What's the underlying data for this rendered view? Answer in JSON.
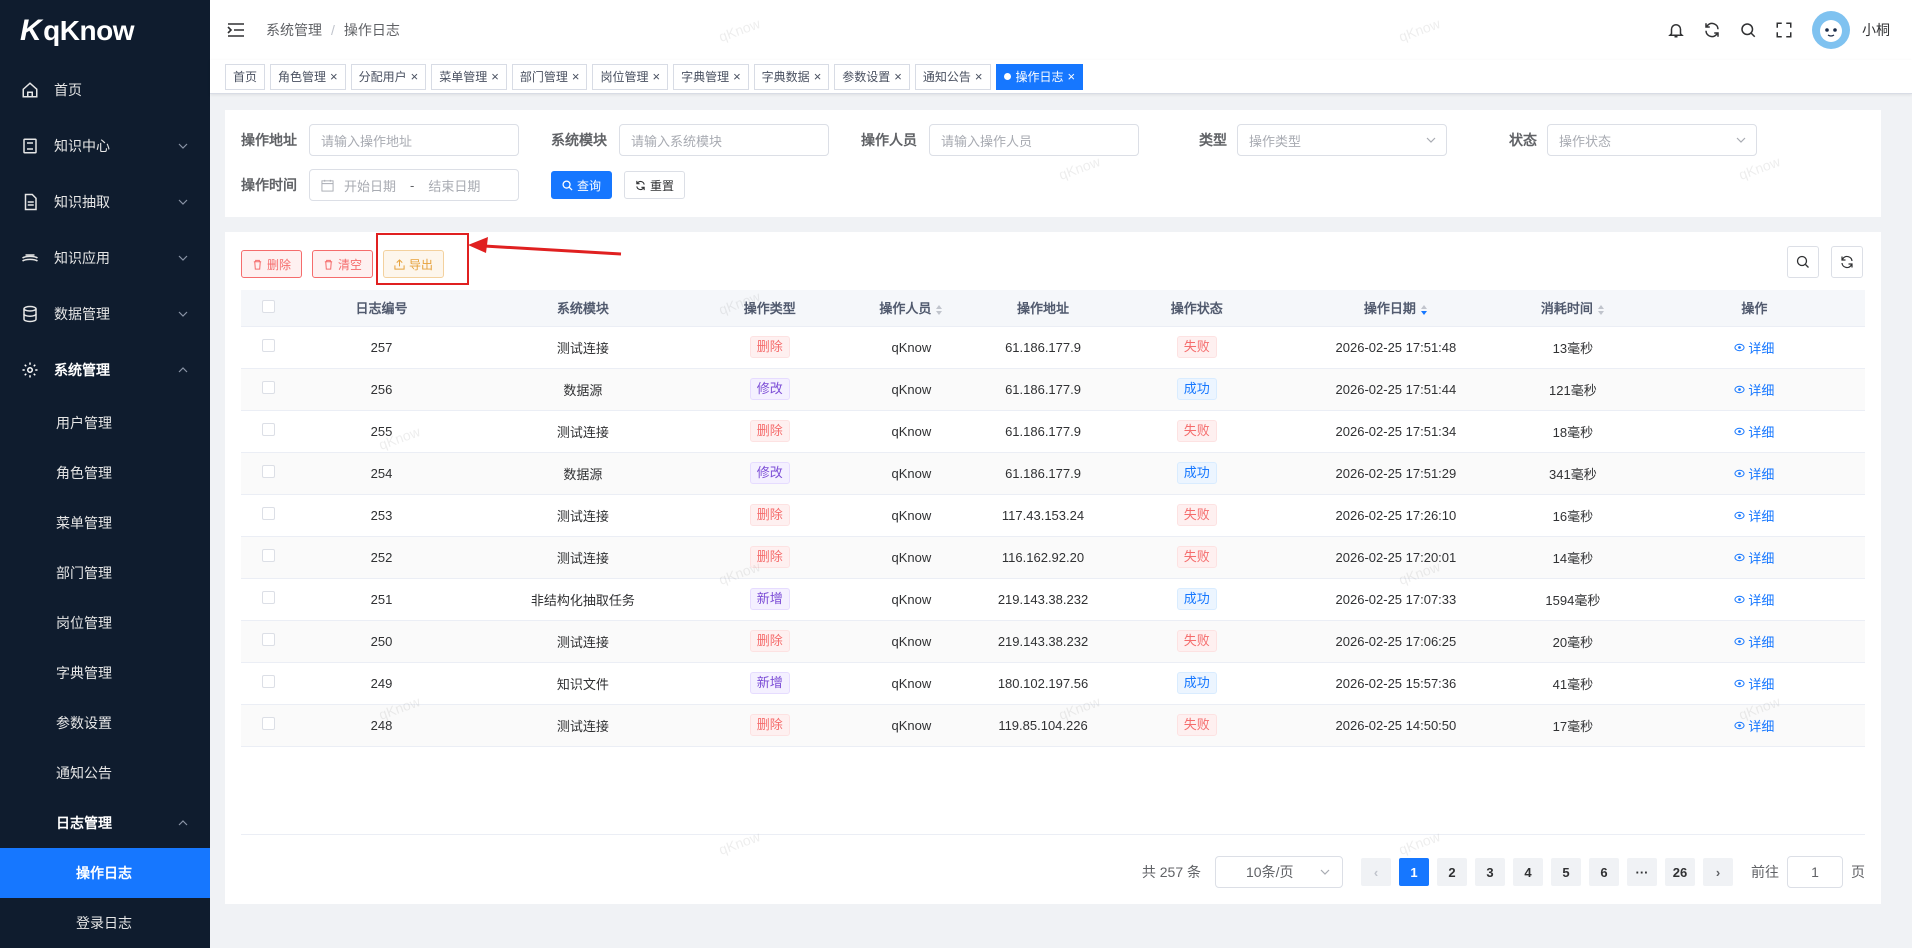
{
  "app": {
    "logo_text": "qKnow",
    "logo_mark": "K"
  },
  "sidebar": {
    "items": [
      {
        "label": "首页",
        "icon": "home-icon"
      },
      {
        "label": "知识中心",
        "icon": "book-icon"
      },
      {
        "label": "知识抽取",
        "icon": "document-icon"
      },
      {
        "label": "知识应用",
        "icon": "stack-icon"
      },
      {
        "label": "数据管理",
        "icon": "database-icon"
      },
      {
        "label": "系统管理",
        "icon": "gear-icon"
      }
    ],
    "system_children": [
      "用户管理",
      "角色管理",
      "菜单管理",
      "部门管理",
      "岗位管理",
      "字典管理",
      "参数设置",
      "通知公告"
    ],
    "log_group": "日志管理",
    "log_children": [
      "操作日志",
      "登录日志"
    ]
  },
  "header": {
    "breadcrumb": [
      "系统管理",
      "操作日志"
    ],
    "username": "小桐"
  },
  "tags": [
    {
      "label": "首页",
      "closable": false,
      "active": false
    },
    {
      "label": "角色管理",
      "closable": true,
      "active": false
    },
    {
      "label": "分配用户",
      "closable": true,
      "active": false
    },
    {
      "label": "菜单管理",
      "closable": true,
      "active": false
    },
    {
      "label": "部门管理",
      "closable": true,
      "active": false
    },
    {
      "label": "岗位管理",
      "closable": true,
      "active": false
    },
    {
      "label": "字典管理",
      "closable": true,
      "active": false
    },
    {
      "label": "字典数据",
      "closable": true,
      "active": false
    },
    {
      "label": "参数设置",
      "closable": true,
      "active": false
    },
    {
      "label": "通知公告",
      "closable": true,
      "active": false
    },
    {
      "label": "操作日志",
      "closable": true,
      "active": true
    }
  ],
  "search": {
    "oper_url_label": "操作地址",
    "oper_url_placeholder": "请输入操作地址",
    "module_label": "系统模块",
    "module_placeholder": "请输入系统模块",
    "oper_name_label": "操作人员",
    "oper_name_placeholder": "请输入操作人员",
    "type_label": "类型",
    "type_placeholder": "操作类型",
    "status_label": "状态",
    "status_placeholder": "操作状态",
    "time_label": "操作时间",
    "start_placeholder": "开始日期",
    "range_sep": "-",
    "end_placeholder": "结束日期",
    "query_btn": "查询",
    "reset_btn": "重置"
  },
  "toolbar": {
    "delete_btn": "删除",
    "clear_btn": "清空",
    "export_btn": "导出"
  },
  "table": {
    "headers": [
      "日志编号",
      "系统模块",
      "操作类型",
      "操作人员",
      "操作地址",
      "操作状态",
      "操作日期",
      "消耗时间",
      "操作"
    ],
    "detail_label": "详细",
    "rows": [
      {
        "id": "257",
        "module": "测试连接",
        "type": "删除",
        "type_color": "red",
        "user": "qKnow",
        "ip": "61.186.177.9",
        "status": "失败",
        "status_color": "red",
        "time": "2026-02-25 17:51:48",
        "cost": "13毫秒"
      },
      {
        "id": "256",
        "module": "数据源",
        "type": "修改",
        "type_color": "purple",
        "user": "qKnow",
        "ip": "61.186.177.9",
        "status": "成功",
        "status_color": "blue",
        "time": "2026-02-25 17:51:44",
        "cost": "121毫秒"
      },
      {
        "id": "255",
        "module": "测试连接",
        "type": "删除",
        "type_color": "red",
        "user": "qKnow",
        "ip": "61.186.177.9",
        "status": "失败",
        "status_color": "red",
        "time": "2026-02-25 17:51:34",
        "cost": "18毫秒"
      },
      {
        "id": "254",
        "module": "数据源",
        "type": "修改",
        "type_color": "purple",
        "user": "qKnow",
        "ip": "61.186.177.9",
        "status": "成功",
        "status_color": "blue",
        "time": "2026-02-25 17:51:29",
        "cost": "341毫秒"
      },
      {
        "id": "253",
        "module": "测试连接",
        "type": "删除",
        "type_color": "red",
        "user": "qKnow",
        "ip": "117.43.153.24",
        "status": "失败",
        "status_color": "red",
        "time": "2026-02-25 17:26:10",
        "cost": "16毫秒"
      },
      {
        "id": "252",
        "module": "测试连接",
        "type": "删除",
        "type_color": "red",
        "user": "qKnow",
        "ip": "116.162.92.20",
        "status": "失败",
        "status_color": "red",
        "time": "2026-02-25 17:20:01",
        "cost": "14毫秒"
      },
      {
        "id": "251",
        "module": "非结构化抽取任务",
        "type": "新增",
        "type_color": "purple",
        "user": "qKnow",
        "ip": "219.143.38.232",
        "status": "成功",
        "status_color": "blue",
        "time": "2026-02-25 17:07:33",
        "cost": "1594毫秒"
      },
      {
        "id": "250",
        "module": "测试连接",
        "type": "删除",
        "type_color": "red",
        "user": "qKnow",
        "ip": "219.143.38.232",
        "status": "失败",
        "status_color": "red",
        "time": "2026-02-25 17:06:25",
        "cost": "20毫秒"
      },
      {
        "id": "249",
        "module": "知识文件",
        "type": "新增",
        "type_color": "purple",
        "user": "qKnow",
        "ip": "180.102.197.56",
        "status": "成功",
        "status_color": "blue",
        "time": "2026-02-25 15:57:36",
        "cost": "41毫秒"
      },
      {
        "id": "248",
        "module": "测试连接",
        "type": "删除",
        "type_color": "red",
        "user": "qKnow",
        "ip": "119.85.104.226",
        "status": "失败",
        "status_color": "red",
        "time": "2026-02-25 14:50:50",
        "cost": "17毫秒"
      }
    ]
  },
  "pagination": {
    "total_text": "共 257 条",
    "page_size": "10条/页",
    "pages": [
      "1",
      "2",
      "3",
      "4",
      "5",
      "6",
      "···",
      "26"
    ],
    "current": "1",
    "goto_label": "前往",
    "goto_value": "1",
    "goto_suffix": "页"
  },
  "colors": {
    "primary": "#1677ff",
    "sidebar_bg": "#0f1c2e",
    "danger": "#f56c6c",
    "warning": "#e6a23c",
    "annotation": "#e02020"
  }
}
